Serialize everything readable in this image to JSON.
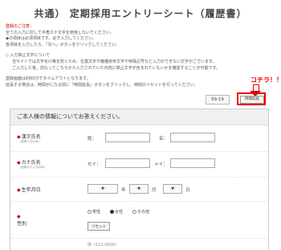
{
  "page_title": "共通） 定期採用エントリーシート（履歴書）",
  "notes": {
    "heading": "登録のご注意：",
    "line1": "全ての入力に対して半角カナ文字を使用しないでください。",
    "line2": "◆の項目は必須項目です。必ず入力してください。",
    "line3": "各項目を入力したら、「次へ」ボタンをクリックしてください。",
    "line4": "◇ 入力禁止文字について",
    "line5": "当サイトでは文字化け等を防ぐため、位置文字や機種依存文字や特殊記号など入力ができない文字がございます。",
    "line6": "ご入力した後、前もってこちらから入力されていた内容に禁止文字が含まれていないかを確認することが可能です。",
    "line7": "登録画面は約60分でタイムアウトとなります。",
    "line8": "延長する場合は、時間がになる前に「時間延長」ボタンをクリックし、時間のリセットを行ってください。"
  },
  "annotation": "コチラ！！",
  "timer": "59:19",
  "extend_button": "時間延長",
  "form": {
    "header": "ご本人様の情報についてお答えください。",
    "name": {
      "label": "漢字氏名",
      "sub": "(全角入力のみ)",
      "last": "姓：",
      "first": "名："
    },
    "kana": {
      "label": "カナ氏名",
      "sub": "(全角カナ入力のみ)",
      "last": "セイ：",
      "first": "メイ："
    },
    "birth": {
      "label": "生年月日",
      "year_sel": "-▼-",
      "year": "年",
      "month_sel": "-▼-",
      "month": "月",
      "day_sel": "-▼-",
      "day": "日"
    },
    "gender": {
      "label": "性別",
      "options": [
        "男性",
        "女性",
        "その他"
      ],
      "reset": "リセット"
    },
    "zip_hint": "例（111-0000）"
  }
}
